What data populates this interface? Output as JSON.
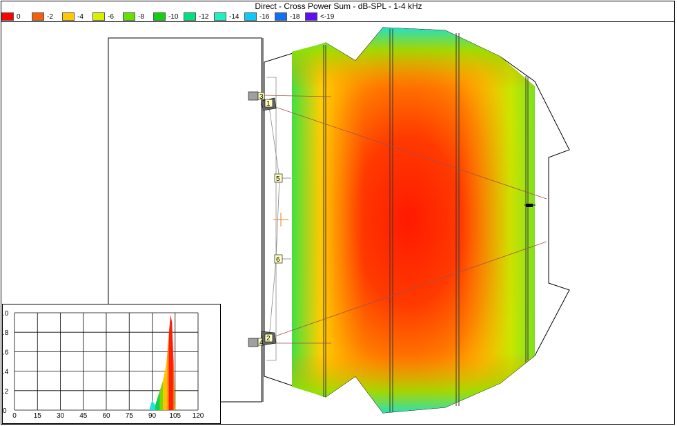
{
  "title": "Direct - Cross Power Sum - dB-SPL - 1-4 kHz",
  "legend": [
    {
      "label": "0",
      "color": "#ff0000"
    },
    {
      "label": "-2",
      "color": "#f06010"
    },
    {
      "label": "-4",
      "color": "#ffc800"
    },
    {
      "label": "-6",
      "color": "#d8f000"
    },
    {
      "label": "-8",
      "color": "#66e000"
    },
    {
      "label": "-10",
      "color": "#10d010"
    },
    {
      "label": "-12",
      "color": "#00e080"
    },
    {
      "label": "-14",
      "color": "#20f0c0"
    },
    {
      "label": "-16",
      "color": "#10c8f8"
    },
    {
      "label": "-18",
      "color": "#1070f0"
    },
    {
      "label": "<-19",
      "color": "#6010f0"
    }
  ],
  "speakers": [
    {
      "label": "1"
    },
    {
      "label": "2"
    },
    {
      "label": "3"
    },
    {
      "label": "4"
    },
    {
      "label": "5"
    },
    {
      "label": "6"
    }
  ],
  "chart_data": {
    "type": "area",
    "x_ticks": [
      "0",
      "15",
      "30",
      "45",
      "60",
      "75",
      "90",
      "105",
      "120"
    ],
    "y_ticks": [
      ".0",
      ".8",
      ".6",
      ".4",
      ".2",
      "0"
    ],
    "xlim": [
      0,
      120
    ],
    "ylim": [
      0,
      1.0
    ],
    "grid": true,
    "series": [
      {
        "x": [
          88,
          90,
          92,
          95,
          97,
          99,
          100,
          101,
          102,
          103,
          104,
          105
        ],
        "values": [
          0,
          0.1,
          0.05,
          0.2,
          0.3,
          0.45,
          0.6,
          0.8,
          0.98,
          0.9,
          0.5,
          0
        ]
      }
    ]
  }
}
